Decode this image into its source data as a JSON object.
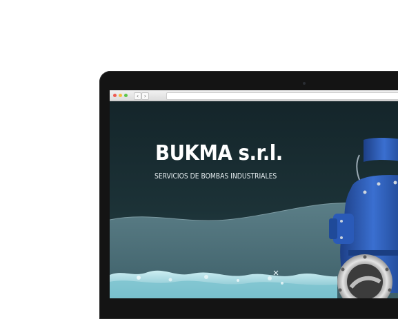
{
  "site": {
    "brand": "BUKMA s.r.l.",
    "tagline": "SERVICIOS DE BOMBAS INDUSTRIALES"
  },
  "browser": {
    "back_glyph": "‹",
    "forward_glyph": "›",
    "address": ""
  },
  "icons": {
    "close": "close-dot-icon",
    "minimize": "minimize-dot-icon",
    "zoom": "zoom-dot-icon",
    "pump": "industrial-pump-icon",
    "water": "water-splash-icon"
  },
  "colors": {
    "hero_dark": "#14252a",
    "wave": "#4a6f78",
    "pump_blue": "#2553a8",
    "water": "#9fd3dc"
  }
}
